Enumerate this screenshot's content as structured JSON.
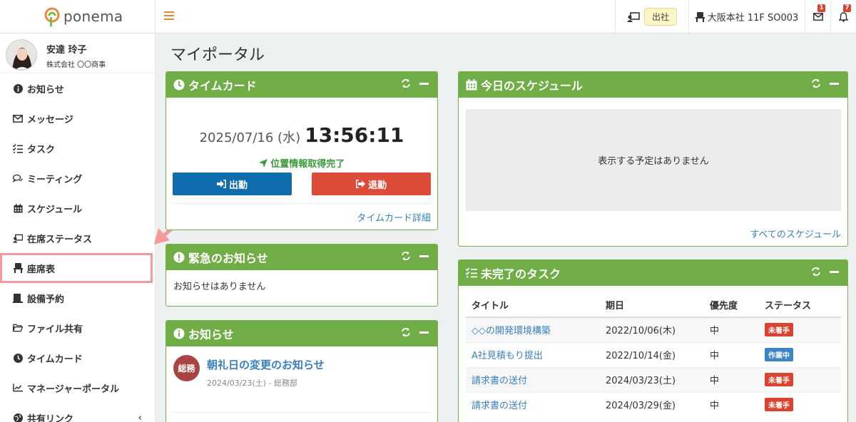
{
  "topbar": {
    "brand": "ponema",
    "status_label": "出社",
    "seat_label": "大阪本社 11F SO003",
    "mail_count": "1",
    "bell_count": "7"
  },
  "profile": {
    "name": "安達 玲子",
    "company": "株式会社 〇〇商事"
  },
  "sidebar": {
    "items": [
      {
        "label": "お知らせ",
        "icon": "info-icon"
      },
      {
        "label": "メッセージ",
        "icon": "envelope-icon"
      },
      {
        "label": "タスク",
        "icon": "checklist-icon"
      },
      {
        "label": "ミーティング",
        "icon": "chat-icon"
      },
      {
        "label": "スケジュール",
        "icon": "calendar-icon"
      },
      {
        "label": "在席ステータス",
        "icon": "presence-icon"
      },
      {
        "label": "座席表",
        "icon": "seat-icon"
      },
      {
        "label": "設備予約",
        "icon": "equipment-icon"
      },
      {
        "label": "ファイル共有",
        "icon": "folder-icon"
      },
      {
        "label": "タイムカード",
        "icon": "clock-icon"
      },
      {
        "label": "マネージャーポータル",
        "icon": "chart-icon"
      },
      {
        "label": "共有リンク",
        "icon": "globe-icon"
      }
    ]
  },
  "page": {
    "title": "マイポータル"
  },
  "timecard": {
    "title": "タイムカード",
    "date": "2025/07/16 (水)",
    "time": "13:56:11",
    "geo_status": "位置情報取得完了",
    "clock_in_label": "出勤",
    "clock_out_label": "退勤",
    "detail_link": "タイムカード詳細"
  },
  "schedule": {
    "title": "今日のスケジュール",
    "empty_text": "表示する予定はありません",
    "all_link": "すべてのスケジュール"
  },
  "emergency": {
    "title": "緊急のお知らせ",
    "empty_text": "お知らせはありません"
  },
  "notices": {
    "title": "お知らせ",
    "items": [
      {
        "category": "総務",
        "title": "朝礼日の変更のお知らせ",
        "meta": "2024/03/23(土) - 総務部"
      }
    ]
  },
  "tasks": {
    "title": "未完了のタスク",
    "headers": [
      "タイトル",
      "期日",
      "優先度",
      "ステータス"
    ],
    "rows": [
      {
        "title": "◇◇の開発環境構築",
        "due": "2022/10/06(木)",
        "priority": "中",
        "status": "未着手",
        "status_color": "#d9442f"
      },
      {
        "title": "A社見積もり提出",
        "due": "2022/10/14(金)",
        "priority": "中",
        "status": "作業中",
        "status_color": "#3c85c2"
      },
      {
        "title": "請求書の送付",
        "due": "2024/03/23(土)",
        "priority": "中",
        "status": "未着手",
        "status_color": "#d9442f"
      },
      {
        "title": "請求書の送付",
        "due": "2024/03/29(金)",
        "priority": "中",
        "status": "未着手",
        "status_color": "#d9442f"
      }
    ]
  },
  "colors": {
    "panel_header": "#70ad47",
    "clock_in": "#0f6dad",
    "clock_out": "#dd4b39",
    "highlight": "#f59a9a",
    "link": "#3a7fbb"
  }
}
